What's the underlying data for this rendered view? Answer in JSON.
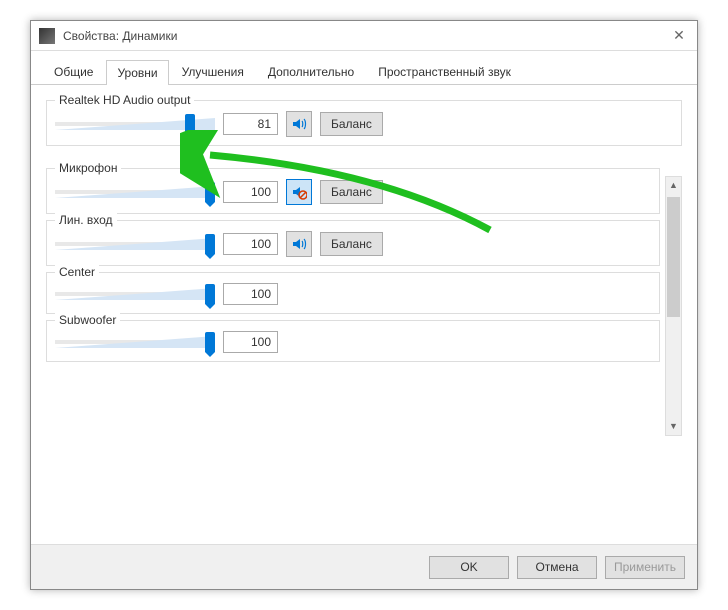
{
  "window": {
    "title": "Свойства: Динамики"
  },
  "tabs": {
    "general": "Общие",
    "levels": "Уровни",
    "enhancements": "Улучшения",
    "advanced": "Дополнительно",
    "spatial": "Пространственный звук"
  },
  "groups": {
    "output": {
      "label": "Realtek HD Audio output",
      "value": "81",
      "balance": "Баланс",
      "slider_pct": 81,
      "muted": false
    },
    "mic": {
      "label": "Микрофон",
      "value": "100",
      "balance": "Баланс",
      "slider_pct": 100,
      "muted": true
    },
    "linein": {
      "label": "Лин. вход",
      "value": "100",
      "balance": "Баланс",
      "slider_pct": 100,
      "muted": false
    },
    "center": {
      "label": "Center",
      "value": "100",
      "slider_pct": 100
    },
    "sub": {
      "label": "Subwoofer",
      "value": "100",
      "slider_pct": 100
    }
  },
  "footer": {
    "ok": "OK",
    "cancel": "Отмена",
    "apply": "Применить"
  }
}
